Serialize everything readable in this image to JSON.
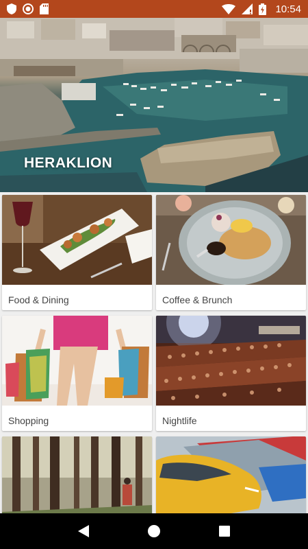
{
  "status_bar": {
    "time": "10:54",
    "icons": [
      "shield-icon",
      "record-icon",
      "sd-card-icon",
      "wifi-icon",
      "no-sim-icon",
      "battery-charging-icon"
    ],
    "color": "#b3471c"
  },
  "hero": {
    "title": "HERAKLION"
  },
  "categories": [
    {
      "label": "Food & Dining"
    },
    {
      "label": "Coffee & Brunch"
    },
    {
      "label": "Shopping"
    },
    {
      "label": "Nightlife"
    },
    {
      "label": ""
    },
    {
      "label": ""
    }
  ],
  "nav_bar": {
    "icons": [
      "back-icon",
      "home-icon",
      "recents-icon"
    ]
  }
}
